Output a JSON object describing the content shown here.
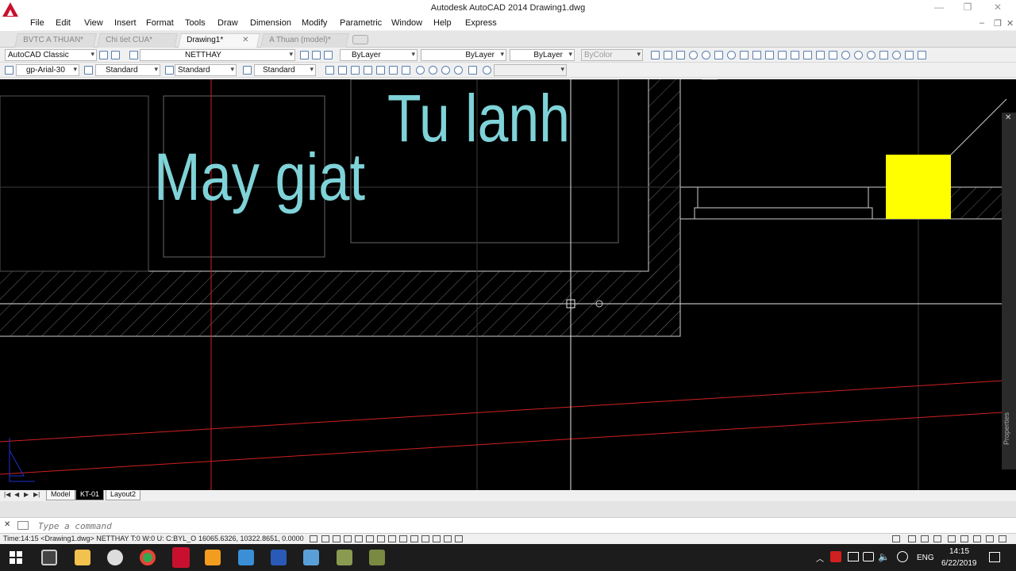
{
  "window": {
    "title": "Autodesk AutoCAD 2014    Drawing1.dwg",
    "minimize": "—",
    "maximize": "❐",
    "close": "✕",
    "doc_min": "–",
    "doc_restore": "❐",
    "doc_close": "✕"
  },
  "menu": [
    "File",
    "Edit",
    "View",
    "Insert",
    "Format",
    "Tools",
    "Draw",
    "Dimension",
    "Modify",
    "Parametric",
    "Window",
    "Help",
    "Express"
  ],
  "tabs": [
    {
      "label": "BVTC A THUAN*"
    },
    {
      "label": "Chi tiet CUA*"
    },
    {
      "label": "Drawing1*",
      "close": "✕"
    },
    {
      "label": "A Thuan (model)*"
    }
  ],
  "toolbar1": {
    "workspace": "AutoCAD Classic",
    "layer": "NETTHAY",
    "color": "ByLayer",
    "linetype": "ByLayer",
    "lineweight": "ByLayer",
    "plotstyle": "ByColor"
  },
  "toolbar2": {
    "text_style": "gp-Arial-30",
    "dim_style": "Standard",
    "table_style": "Standard",
    "mleader_style": "Standard"
  },
  "drawing": {
    "text_may_giat": "May giat",
    "text_tu_lanh": "Tu lanh",
    "highlight_color": "#ffff00",
    "text_color": "#7fd3d8",
    "axis_color": "#d02020",
    "ucs_color": "#2030d0"
  },
  "palette": {
    "label": "Properties",
    "close": "✕"
  },
  "layout_tabs": {
    "nav": [
      "|◀",
      "◀",
      "▶",
      "▶|"
    ],
    "tabs": [
      "Model",
      "KT-01",
      "Layout2"
    ]
  },
  "command": {
    "close": "✕",
    "placeholder": "Type a command"
  },
  "status": {
    "text": "Time:14:15 <Drawing1.dwg> NETTHAY T:0 W:0 U: C:BYL_O",
    "coords": "16065.6326, 10322.8651, 0.0000"
  },
  "taskbar": {
    "language": "ENG",
    "time": "14:15",
    "date": "6/22/2019"
  }
}
